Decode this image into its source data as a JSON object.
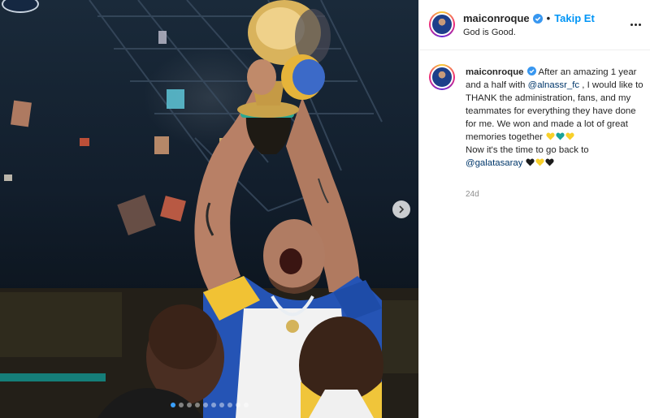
{
  "post": {
    "username": "maiconroque",
    "separator": "•",
    "follow_label": "Takip Et",
    "location": "God is Good.",
    "caption": {
      "username": "maiconroque",
      "line_parts": [
        "After an amazing 1 year and a half with ",
        "@alnassr_fc",
        " , I would like to THANK the administration, fans, and my teammates for everything they have done for me. We won and made a lot of great memories together ",
        "Now it's the time to go back to ",
        "@galatasaray"
      ],
      "hearts_line1": [
        "yellow",
        "teal",
        "yellow"
      ],
      "hearts_line2": [
        "black",
        "yellow",
        "black"
      ]
    },
    "time_ago": "24d"
  },
  "carousel": {
    "dot_count": 10,
    "active_index": 0
  },
  "colors": {
    "accent": "#0095f6",
    "mention": "#00376b",
    "verified": "#3897f0",
    "heart_yellow": "#f8d02a",
    "heart_teal": "#1aa39a",
    "heart_black": "#1b1b1b"
  },
  "icons": {
    "verified": "verified-badge-icon",
    "more": "more-options-icon",
    "next": "chevron-right-icon"
  }
}
